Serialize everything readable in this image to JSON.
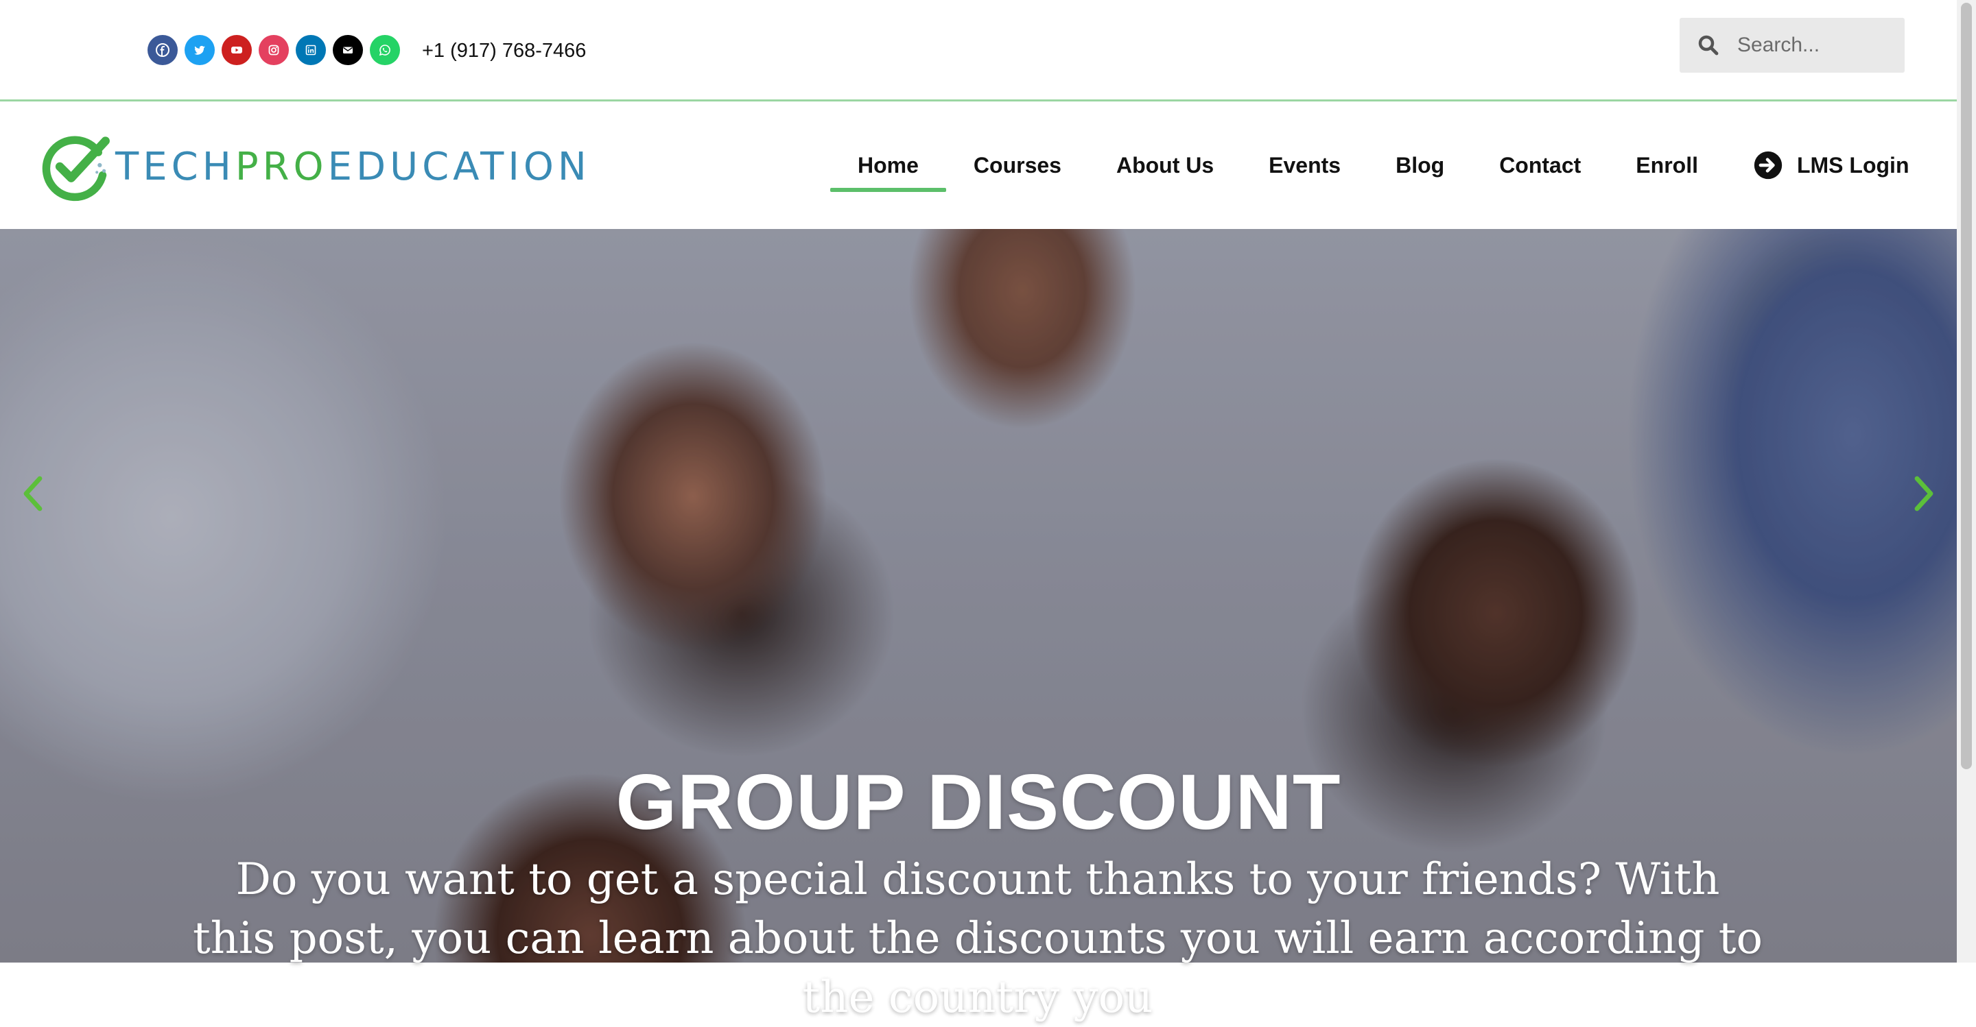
{
  "topbar": {
    "socials": [
      {
        "name": "facebook-icon",
        "color": "#3b5998"
      },
      {
        "name": "twitter-icon",
        "color": "#1da1f2"
      },
      {
        "name": "youtube-icon",
        "color": "#cd201f"
      },
      {
        "name": "instagram-icon",
        "color": "#e4405f"
      },
      {
        "name": "linkedin-icon",
        "color": "#0077b5"
      },
      {
        "name": "envelope-icon",
        "color": "#000000"
      },
      {
        "name": "whatsapp-icon",
        "color": "#25d366"
      }
    ],
    "phone": "+1 (917) 768-7466",
    "search": {
      "placeholder": "Search...",
      "value": ""
    }
  },
  "header": {
    "logo": {
      "part1": "TECH",
      "part2": "PRO",
      "part3": "EDUCATION"
    },
    "nav": [
      {
        "label": "Home",
        "active": true
      },
      {
        "label": "Courses"
      },
      {
        "label": "About Us"
      },
      {
        "label": "Events"
      },
      {
        "label": "Blog"
      },
      {
        "label": "Contact"
      },
      {
        "label": "Enroll"
      },
      {
        "label": "LMS Login",
        "icon": "arrow-circle-right-icon"
      }
    ]
  },
  "hero": {
    "title": "GROUP DISCOUNT",
    "text": "Do you want to get a special discount thanks to your friends? With this post, you can learn about the discounts you will earn according to the country you",
    "arrow_color": "#5cbf3a"
  },
  "colors": {
    "accent": "#5cbf6a",
    "brand_blue": "#3a8bb5",
    "brand_green": "#44b047"
  }
}
